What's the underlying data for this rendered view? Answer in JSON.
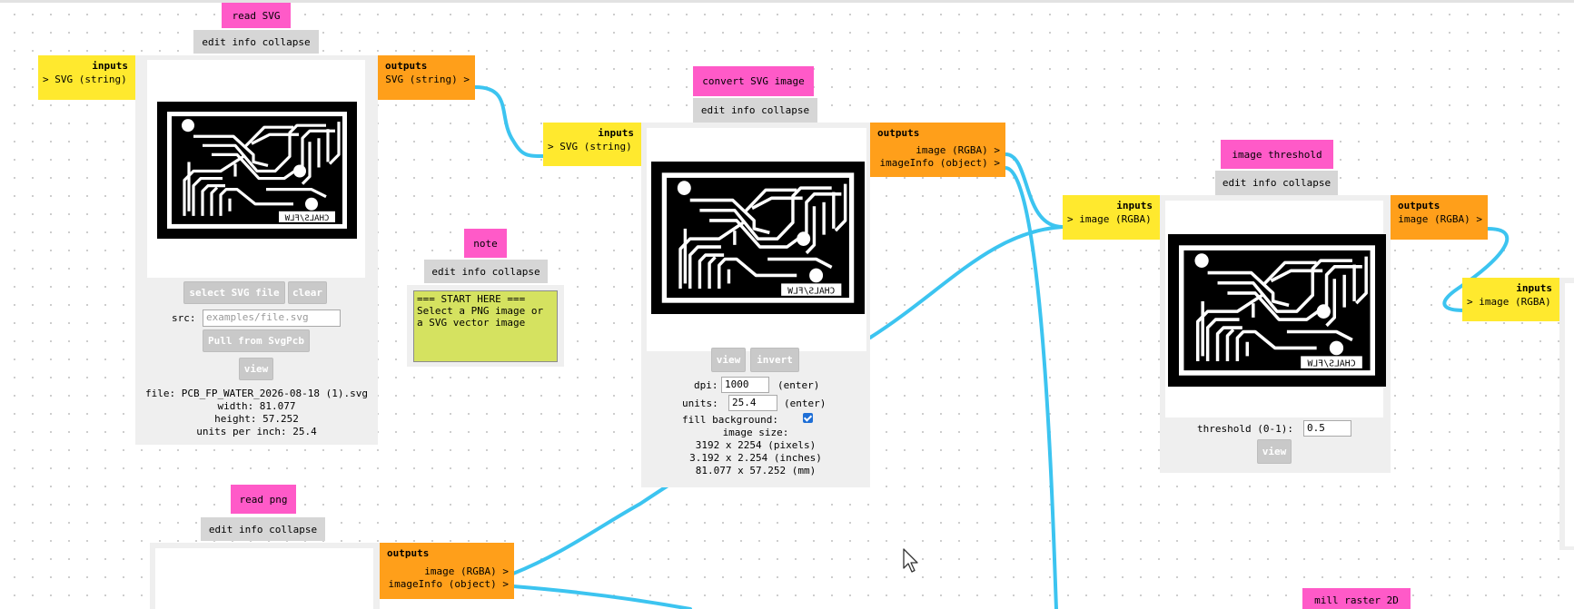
{
  "common": {
    "edit_info_collapse": "edit info collapse",
    "inputs": "inputs",
    "outputs": "outputs"
  },
  "read_svg": {
    "title": "read SVG",
    "input": "> SVG (string)",
    "output": "SVG (string) >",
    "select_btn": "select SVG file",
    "clear_btn": "clear",
    "src_label": "src:",
    "src_placeholder": "examples/file.svg",
    "pull_btn": "Pull from SvgPcb",
    "view_btn": "view",
    "info": [
      "file: PCB_FP_WATER_2026-08-18 (1).svg",
      "width: 81.077",
      "height: 57.252",
      "units per inch: 25.4"
    ]
  },
  "note": {
    "title": "note",
    "text": "=== START HERE ===\nSelect a PNG image or\na SVG vector image"
  },
  "convert_svg": {
    "title": "convert SVG image",
    "input": "> SVG (string)",
    "outputs": [
      "image (RGBA) >",
      "imageInfo (object) >"
    ],
    "view_btn": "view",
    "invert_btn": "invert",
    "dpi_label": "dpi:",
    "dpi_value": "1000",
    "dpi_enter": "(enter)",
    "units_label": "units:",
    "units_value": "25.4",
    "units_enter": "(enter)",
    "fill_label": "fill background:",
    "fill_checked": true,
    "size_label": "image size:",
    "size_lines": [
      "3192 x 2254 (pixels)",
      "3.192 x 2.254 (inches)",
      "81.077 x 57.252 (mm)"
    ]
  },
  "threshold": {
    "title": "image threshold",
    "input": "> image (RGBA)",
    "output": "image (RGBA) >",
    "label": "threshold (0-1):",
    "value": "0.5",
    "view_btn": "view"
  },
  "next_node": {
    "input": "> image (RGBA)"
  },
  "read_png": {
    "title": "read png",
    "outputs": [
      "image (RGBA) >",
      "imageInfo (object) >"
    ]
  },
  "mill": {
    "title": "mill raster 2D"
  },
  "pcb_labels": {
    "silk": "CHALS/FLW"
  },
  "colors": {
    "wire": "#3cc4f0",
    "title": "#ff5ac8",
    "inputs": "#ffe92e",
    "outputs": "#ff9f1a",
    "note": "#d5e260"
  }
}
